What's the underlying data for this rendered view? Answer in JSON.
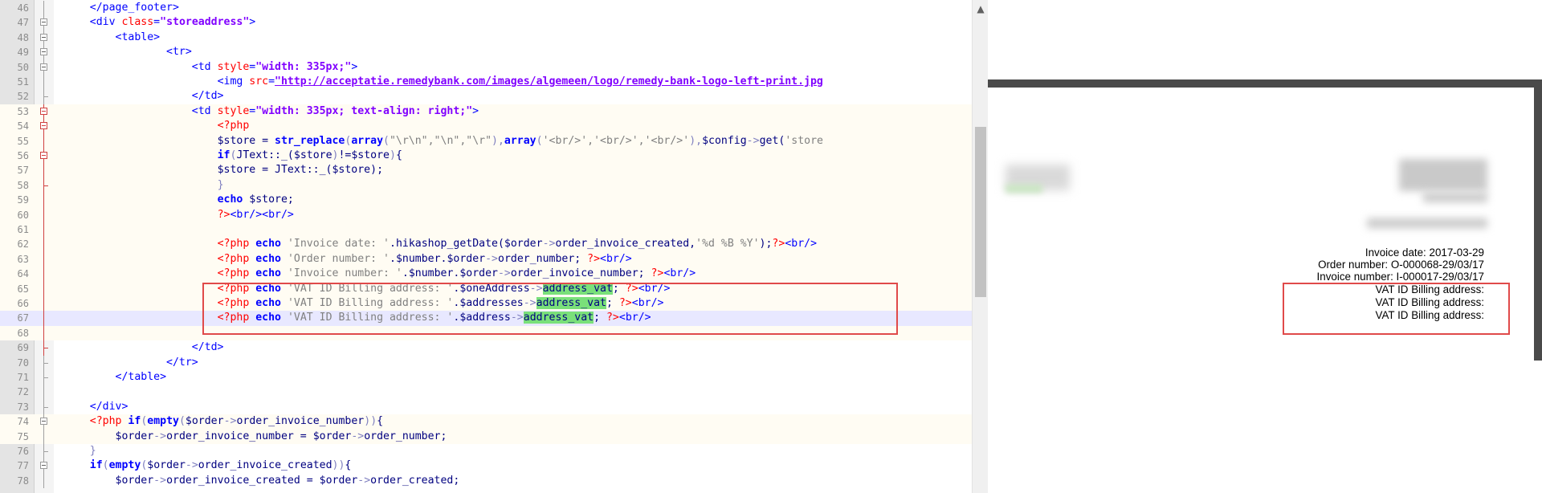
{
  "editor": {
    "lines": [
      {
        "n": "46",
        "fold": "line",
        "tokens": [
          [
            "plain",
            "    "
          ],
          [
            "tag",
            "</page_footer>"
          ]
        ]
      },
      {
        "n": "47",
        "fold": "box",
        "tokens": [
          [
            "plain",
            "    "
          ],
          [
            "tag",
            "<div "
          ],
          [
            "attr",
            "class"
          ],
          [
            "tag",
            "="
          ],
          [
            "attrval",
            "\"storeaddress\""
          ],
          [
            "tag",
            ">"
          ]
        ]
      },
      {
        "n": "48",
        "fold": "box",
        "tokens": [
          [
            "plain",
            "        "
          ],
          [
            "tag",
            "<table>"
          ]
        ]
      },
      {
        "n": "49",
        "fold": "box",
        "tokens": [
          [
            "plain",
            "                "
          ],
          [
            "tag",
            "<tr>"
          ]
        ]
      },
      {
        "n": "50",
        "fold": "box",
        "tokens": [
          [
            "plain",
            "                    "
          ],
          [
            "tag",
            "<td "
          ],
          [
            "attr",
            "style"
          ],
          [
            "tag",
            "="
          ],
          [
            "attrval",
            "\"width: 335px;\""
          ],
          [
            "tag",
            ">"
          ]
        ]
      },
      {
        "n": "51",
        "fold": "line",
        "tokens": [
          [
            "plain",
            "                        "
          ],
          [
            "tag",
            "<img "
          ],
          [
            "attr",
            "src"
          ],
          [
            "tag",
            "="
          ],
          [
            "url",
            "\"http://acceptatie.remedybank.com/images/algemeen/logo/remedy-bank-logo-left-print.jpg"
          ]
        ]
      },
      {
        "n": "52",
        "fold": "tick",
        "tokens": [
          [
            "plain",
            "                    "
          ],
          [
            "tag",
            "</td>"
          ]
        ]
      },
      {
        "n": "53",
        "fold": "boxred",
        "tokens": [
          [
            "plain",
            "                    "
          ],
          [
            "tag",
            "<td "
          ],
          [
            "attr",
            "style"
          ],
          [
            "tag",
            "="
          ],
          [
            "attrval",
            "\"width: 335px; text-align: right;\""
          ],
          [
            "tag",
            ">"
          ]
        ]
      },
      {
        "n": "54",
        "fold": "boxred",
        "tokens": [
          [
            "plain",
            "                        "
          ],
          [
            "php",
            "<?php"
          ]
        ]
      },
      {
        "n": "55",
        "fold": "linered",
        "tokens": [
          [
            "plain",
            "                        "
          ],
          [
            "var",
            "$store"
          ],
          [
            "plain",
            " = "
          ],
          [
            "kw",
            "str_replace"
          ],
          [
            "op",
            "("
          ],
          [
            "kw",
            "array"
          ],
          [
            "op",
            "("
          ],
          [
            "str",
            "\"\\r\\n\",\"\\n\",\"\\r\""
          ],
          [
            "op",
            "),"
          ],
          [
            "kw",
            "array"
          ],
          [
            "op",
            "("
          ],
          [
            "str",
            "'<br/>','<br/>','<br/>'"
          ],
          [
            "op",
            "),"
          ],
          [
            "var",
            "$config"
          ],
          [
            "op",
            "->"
          ],
          [
            "plain",
            "get("
          ],
          [
            "str",
            "'store"
          ]
        ]
      },
      {
        "n": "56",
        "fold": "boxred",
        "tokens": [
          [
            "plain",
            "                        "
          ],
          [
            "kw",
            "if"
          ],
          [
            "op",
            "("
          ],
          [
            "plain",
            "JText::_("
          ],
          [
            "var",
            "$store"
          ],
          [
            "op",
            ")"
          ],
          [
            "plain",
            "!="
          ],
          [
            "var",
            "$store"
          ],
          [
            "op",
            ")"
          ],
          [
            "plain",
            "{"
          ]
        ]
      },
      {
        "n": "57",
        "fold": "linered",
        "tokens": [
          [
            "plain",
            "                        "
          ],
          [
            "var",
            "$store"
          ],
          [
            "plain",
            " = JText::_("
          ],
          [
            "var",
            "$store"
          ],
          [
            "plain",
            ");"
          ]
        ]
      },
      {
        "n": "58",
        "fold": "tickred",
        "tokens": [
          [
            "plain",
            "                        "
          ],
          [
            "op",
            "}"
          ]
        ]
      },
      {
        "n": "59",
        "fold": "linered",
        "tokens": [
          [
            "plain",
            "                        "
          ],
          [
            "kw",
            "echo"
          ],
          [
            "plain",
            " "
          ],
          [
            "var",
            "$store"
          ],
          [
            "plain",
            ";"
          ]
        ]
      },
      {
        "n": "60",
        "fold": "linered",
        "tokens": [
          [
            "plain",
            "                        "
          ],
          [
            "php",
            "?>"
          ],
          [
            "tag",
            "<br/><br/>"
          ]
        ]
      },
      {
        "n": "61",
        "fold": "linered",
        "tokens": []
      },
      {
        "n": "62",
        "fold": "linered",
        "tokens": [
          [
            "plain",
            "                        "
          ],
          [
            "php",
            "<?php"
          ],
          [
            "plain",
            " "
          ],
          [
            "kw",
            "echo"
          ],
          [
            "plain",
            " "
          ],
          [
            "str",
            "'Invoice date: '"
          ],
          [
            "plain",
            "."
          ],
          [
            "plain",
            "hikashop_getDate("
          ],
          [
            "var",
            "$order"
          ],
          [
            "op",
            "->"
          ],
          [
            "plain",
            "order_invoice_created,"
          ],
          [
            "str",
            "'%d %B %Y'"
          ],
          [
            "plain",
            ");"
          ],
          [
            "php",
            "?>"
          ],
          [
            "tag",
            "<br/>"
          ]
        ]
      },
      {
        "n": "63",
        "fold": "linered",
        "tokens": [
          [
            "plain",
            "                        "
          ],
          [
            "php",
            "<?php"
          ],
          [
            "plain",
            " "
          ],
          [
            "kw",
            "echo"
          ],
          [
            "plain",
            " "
          ],
          [
            "str",
            "'Order number: '"
          ],
          [
            "plain",
            "."
          ],
          [
            "var",
            "$number"
          ],
          [
            "plain",
            "."
          ],
          [
            "var",
            "$order"
          ],
          [
            "op",
            "->"
          ],
          [
            "plain",
            "order_number; "
          ],
          [
            "php",
            "?>"
          ],
          [
            "tag",
            "<br/>"
          ]
        ]
      },
      {
        "n": "64",
        "fold": "linered",
        "tokens": [
          [
            "plain",
            "                        "
          ],
          [
            "php",
            "<?php"
          ],
          [
            "plain",
            " "
          ],
          [
            "kw",
            "echo"
          ],
          [
            "plain",
            " "
          ],
          [
            "str",
            "'Invoice number: '"
          ],
          [
            "plain",
            "."
          ],
          [
            "var",
            "$number"
          ],
          [
            "plain",
            "."
          ],
          [
            "var",
            "$order"
          ],
          [
            "op",
            "->"
          ],
          [
            "plain",
            "order_invoice_number; "
          ],
          [
            "php",
            "?>"
          ],
          [
            "tag",
            "<br/>"
          ]
        ]
      },
      {
        "n": "65",
        "fold": "linered",
        "tokens": [
          [
            "plain",
            "                        "
          ],
          [
            "php",
            "<?php"
          ],
          [
            "plain",
            " "
          ],
          [
            "kw",
            "echo"
          ],
          [
            "plain",
            " "
          ],
          [
            "str",
            "'VAT ID Billing address: '"
          ],
          [
            "plain",
            "."
          ],
          [
            "var",
            "$oneAddress"
          ],
          [
            "op",
            "->"
          ],
          [
            "hl",
            "address_vat"
          ],
          [
            "plain",
            "; "
          ],
          [
            "php",
            "?>"
          ],
          [
            "tag",
            "<br/>"
          ]
        ]
      },
      {
        "n": "66",
        "fold": "linered",
        "tokens": [
          [
            "plain",
            "                        "
          ],
          [
            "php",
            "<?php"
          ],
          [
            "plain",
            " "
          ],
          [
            "kw",
            "echo"
          ],
          [
            "plain",
            " "
          ],
          [
            "str",
            "'VAT ID Billing address: '"
          ],
          [
            "plain",
            "."
          ],
          [
            "var",
            "$addresses"
          ],
          [
            "op",
            "->"
          ],
          [
            "hl",
            "address_vat"
          ],
          [
            "plain",
            "; "
          ],
          [
            "php",
            "?>"
          ],
          [
            "tag",
            "<br/>"
          ]
        ]
      },
      {
        "n": "67",
        "fold": "linered",
        "tokens": [
          [
            "plain",
            "                        "
          ],
          [
            "php",
            "<?php"
          ],
          [
            "plain",
            " "
          ],
          [
            "kw",
            "echo"
          ],
          [
            "plain",
            " "
          ],
          [
            "str",
            "'VAT ID Billing address: '"
          ],
          [
            "plain",
            "."
          ],
          [
            "var",
            "$address"
          ],
          [
            "op",
            "->"
          ],
          [
            "hl",
            "address_vat"
          ],
          [
            "plain",
            "; "
          ],
          [
            "php",
            "?>"
          ],
          [
            "tag",
            "<br/>"
          ]
        ]
      },
      {
        "n": "68",
        "fold": "linered",
        "tokens": []
      },
      {
        "n": "69",
        "fold": "tickred",
        "tokens": [
          [
            "plain",
            "                    "
          ],
          [
            "tag",
            "</td>"
          ]
        ]
      },
      {
        "n": "70",
        "fold": "tick",
        "tokens": [
          [
            "plain",
            "                "
          ],
          [
            "tag",
            "</tr>"
          ]
        ]
      },
      {
        "n": "71",
        "fold": "tick",
        "tokens": [
          [
            "plain",
            "        "
          ],
          [
            "tag",
            "</table>"
          ]
        ]
      },
      {
        "n": "72",
        "fold": "line",
        "tokens": []
      },
      {
        "n": "73",
        "fold": "tick",
        "tokens": [
          [
            "plain",
            "    "
          ],
          [
            "tag",
            "</div>"
          ]
        ]
      },
      {
        "n": "74",
        "fold": "box",
        "tokens": [
          [
            "plain",
            "    "
          ],
          [
            "php",
            "<?php"
          ],
          [
            "plain",
            " "
          ],
          [
            "kw",
            "if"
          ],
          [
            "op",
            "("
          ],
          [
            "kw",
            "empty"
          ],
          [
            "op",
            "("
          ],
          [
            "var",
            "$order"
          ],
          [
            "op",
            "->"
          ],
          [
            "plain",
            "order_invoice_number"
          ],
          [
            "op",
            "))"
          ],
          [
            "plain",
            "{"
          ]
        ]
      },
      {
        "n": "75",
        "fold": "line",
        "tokens": [
          [
            "plain",
            "        "
          ],
          [
            "var",
            "$order"
          ],
          [
            "op",
            "->"
          ],
          [
            "plain",
            "order_invoice_number = "
          ],
          [
            "var",
            "$order"
          ],
          [
            "op",
            "->"
          ],
          [
            "plain",
            "order_number;"
          ]
        ]
      },
      {
        "n": "76",
        "fold": "tick",
        "tokens": [
          [
            "plain",
            "    "
          ],
          [
            "op",
            "}"
          ]
        ]
      },
      {
        "n": "77",
        "fold": "box",
        "tokens": [
          [
            "plain",
            "    "
          ],
          [
            "kw",
            "if"
          ],
          [
            "op",
            "("
          ],
          [
            "kw",
            "empty"
          ],
          [
            "op",
            "("
          ],
          [
            "var",
            "$order"
          ],
          [
            "op",
            "->"
          ],
          [
            "plain",
            "order_invoice_created"
          ],
          [
            "op",
            "))"
          ],
          [
            "plain",
            "{"
          ]
        ]
      },
      {
        "n": "78",
        "fold": "line",
        "tokens": [
          [
            "plain",
            "        "
          ],
          [
            "var",
            "$order"
          ],
          [
            "op",
            "->"
          ],
          [
            "plain",
            "order_invoice_created = "
          ],
          [
            "var",
            "$order"
          ],
          [
            "op",
            "->"
          ],
          [
            "plain",
            "order_created;"
          ]
        ]
      }
    ],
    "current_line": "67",
    "scroll_up_icon": "▲"
  },
  "preview": {
    "invoice_date": "Invoice date: 2017-03-29",
    "order_number": "Order number: O-000068-29/03/17",
    "invoice_number": "Invoice number: I-000017-29/03/17",
    "vat_lines": [
      "VAT ID Billing address:",
      "VAT ID Billing address:",
      "VAT ID Billing address:"
    ]
  },
  "colors": {
    "highlight_box": "#e04a4a",
    "match_highlight": "#7ae07a"
  }
}
